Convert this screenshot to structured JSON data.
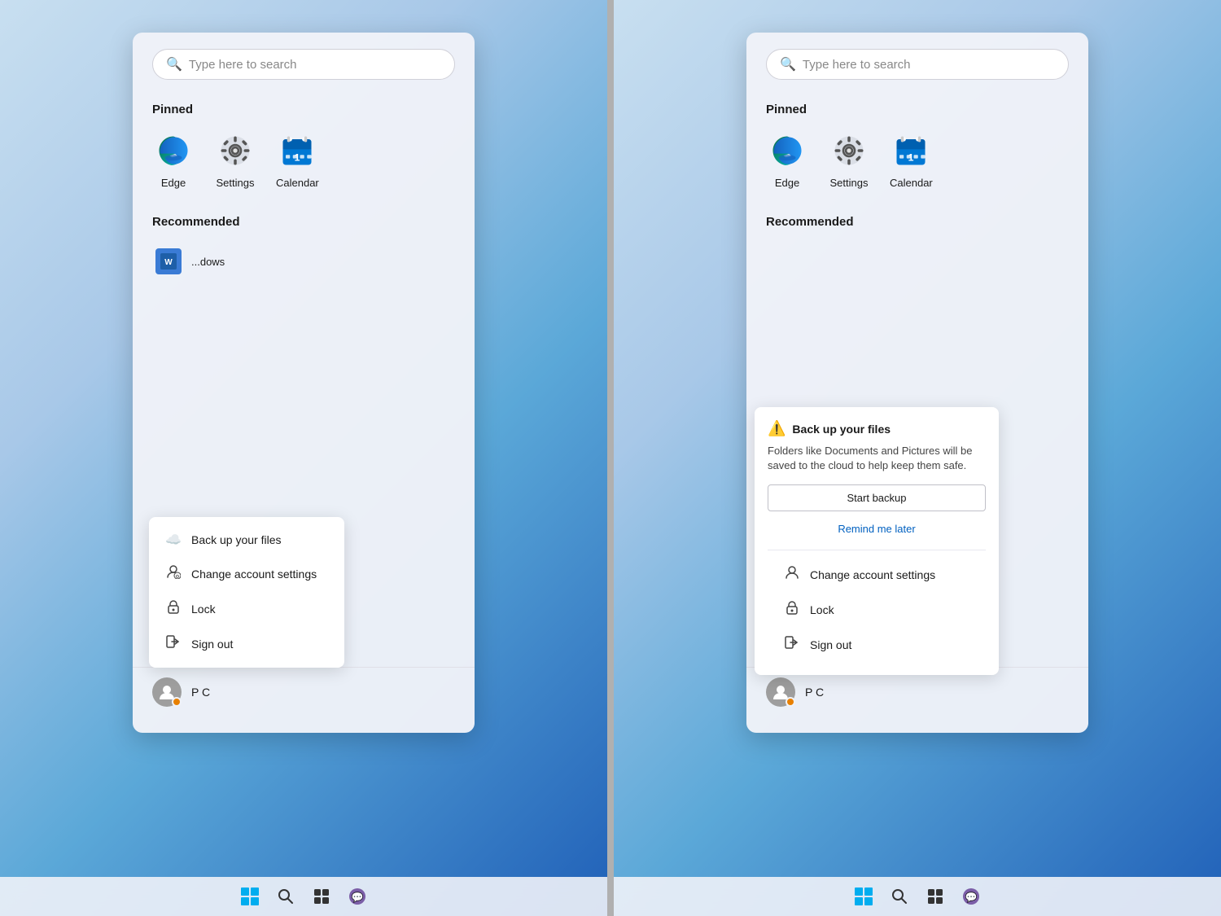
{
  "panel_left": {
    "search": {
      "placeholder": "Type here to search"
    },
    "pinned_label": "Pinned",
    "apps": [
      {
        "id": "edge",
        "label": "Edge"
      },
      {
        "id": "settings",
        "label": "Settings"
      },
      {
        "id": "calendar",
        "label": "Calendar"
      }
    ],
    "recommended_label": "Recommended",
    "recommended_items": [
      {
        "label": "...dows"
      }
    ],
    "context_menu": {
      "items": [
        {
          "id": "backup",
          "icon": "☁",
          "label": "Back up your files"
        },
        {
          "id": "account",
          "icon": "👤",
          "label": "Change account settings"
        },
        {
          "id": "lock",
          "icon": "🔒",
          "label": "Lock"
        },
        {
          "id": "signout",
          "icon": "🚪",
          "label": "Sign out"
        }
      ]
    },
    "user": {
      "name": "P C"
    }
  },
  "panel_right": {
    "search": {
      "placeholder": "Type here to search"
    },
    "pinned_label": "Pinned",
    "apps": [
      {
        "id": "edge",
        "label": "Edge"
      },
      {
        "id": "settings",
        "label": "Settings"
      },
      {
        "id": "calendar",
        "label": "Calendar"
      }
    ],
    "recommended_label": "Recommended",
    "backup_card": {
      "title": "Back up your files",
      "description": "Folders like Documents and Pictures will be saved to the cloud to help keep them safe.",
      "primary_btn": "Start backup",
      "secondary_btn": "Remind me later"
    },
    "context_menu": {
      "items": [
        {
          "id": "account",
          "icon": "👤",
          "label": "Change account settings"
        },
        {
          "id": "lock",
          "icon": "🔒",
          "label": "Lock"
        },
        {
          "id": "signout",
          "icon": "🚪",
          "label": "Sign out"
        }
      ]
    },
    "user": {
      "name": "P C"
    }
  },
  "taskbar": {
    "icons": [
      {
        "id": "start",
        "label": "Start"
      },
      {
        "id": "search",
        "label": "Search"
      },
      {
        "id": "task-view",
        "label": "Task View"
      },
      {
        "id": "chat",
        "label": "Chat"
      }
    ]
  }
}
